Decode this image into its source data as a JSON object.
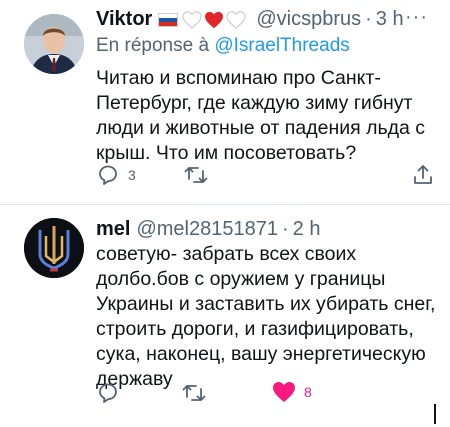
{
  "tweets": [
    {
      "author": {
        "name": "Viktor",
        "handle": "@vicspbrus",
        "time": "3 h",
        "flag": "russia-flag-icon",
        "hearts": [
          "white-heart-icon",
          "red-heart-icon",
          "white-heart-icon"
        ]
      },
      "reply_prefix": "En réponse à",
      "reply_mention": "@IsraelThreads",
      "text": "Читаю и вспоминаю про Санкт-Петербург, где каждую зиму гибнут люди и животные от падения льда с крыш. Что им посоветовать?",
      "actions": {
        "reply_count": "3",
        "retweet_count": "",
        "like_count": ""
      }
    },
    {
      "author": {
        "name": "mel",
        "handle": "@mel28151871",
        "time": "2 h"
      },
      "text": "советую- забрать всех своих долбо.бов с оружием у границы Украины и заставить их убирать снег, строить дороги, и газифицировать, сука, наконец, вашу энергетическую державу",
      "actions": {
        "reply_count": "",
        "retweet_count": "",
        "like_count": "8",
        "liked": true
      }
    }
  ],
  "ui": {
    "more_label": "···",
    "dot": "·"
  },
  "colors": {
    "text": "#0f1419",
    "secondary": "#536471",
    "link": "#1d9bf0",
    "like": "#f91880",
    "divider": "#e1e6ea"
  }
}
